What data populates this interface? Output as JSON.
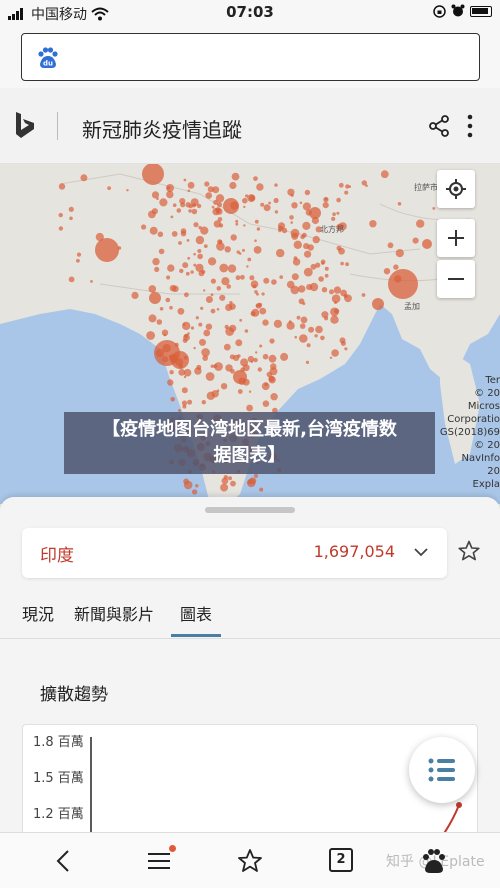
{
  "status_bar": {
    "carrier": "中国移动",
    "time": "07:03"
  },
  "browser": {
    "search_logo": "du"
  },
  "app": {
    "title": "新冠肺炎疫情追蹤"
  },
  "map": {
    "place_labels": {
      "tibet_small": "拉萨市",
      "up_small": "北方邦",
      "bd_small": "孟加"
    },
    "attribution_lines": [
      "Ter",
      "© 20",
      "Micros",
      "Corporatio",
      "GS(2018)69",
      "© 20",
      "NavInfo",
      "20",
      "Expla"
    ],
    "marker_color": "#d9603b",
    "land_color": "#e6e4df",
    "water_color": "#a9c6e8"
  },
  "banner": {
    "line1": "【疫情地图台湾地区最新,台湾疫情数",
    "line2": "据图表】"
  },
  "panel": {
    "country_name": "印度",
    "country_count": "1,697,054",
    "tabs": [
      "現況",
      "新聞與影片",
      "圖表"
    ],
    "active_tab": "圖表",
    "section_title": "擴散趨勢",
    "y_ticks": [
      "1.8 百萬",
      "1.5 百萬",
      "1.2 百萬"
    ],
    "accent_color": "#4a7fa4",
    "count_color": "#c0392b"
  },
  "bottom_nav": {
    "tab_count": "2",
    "watermark": "知乎 @LEplate"
  }
}
